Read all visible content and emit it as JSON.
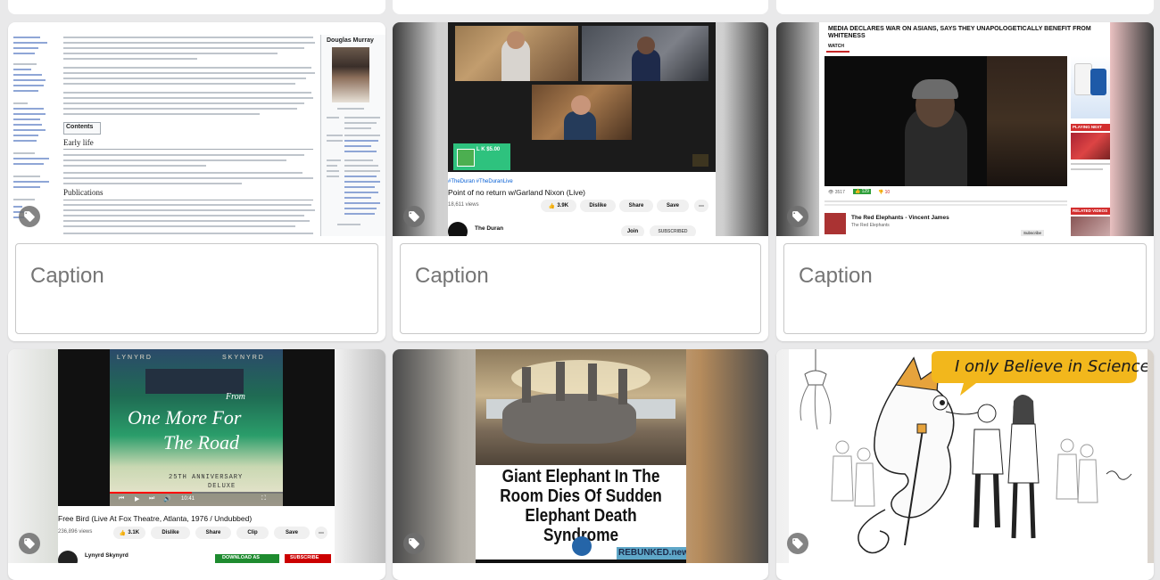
{
  "caption_placeholder": "Caption",
  "cards": {
    "wiki": {
      "infobox_title": "Douglas Murray",
      "section_early_life": "Early life",
      "section_publications": "Publications",
      "contents_label": "Contents"
    },
    "duran": {
      "hashtags": "#TheDuran #TheDuranLive",
      "title": "Point of no return w/Garland Nixon (Live)",
      "views": "18,611 views",
      "likes": "3.9K",
      "dislike": "Dislike",
      "share": "Share",
      "save": "Save",
      "channel": "The Duran",
      "join": "Join",
      "subscribed": "SUBSCRIBED",
      "donation": "L K  $5.00"
    },
    "asians": {
      "headline": "MEDIA DECLARES WAR ON ASIANS, SAYS THEY UNAPOLOGETICALLY BENEFIT FROM WHITENESS",
      "watch": "WATCH",
      "views": "3517",
      "likes": "129",
      "dislikes": "10",
      "channel": "The Red Elephants - Vincent James",
      "channel_sub": "The Red Elephants",
      "subscribe": "Subscribe",
      "playing_next": "PLAYING NEXT",
      "related": "RELATED VIDEOS"
    },
    "skynyrd": {
      "band_left": "LYNYRD",
      "band_right": "SKYNYRD",
      "from": "From",
      "album_line1": "One More For",
      "album_line2": "The Road",
      "anniversary": "25TH ANNIVERSARY",
      "deluxe": "DELUXE",
      "time": "10:41",
      "title": "Free Bird (Live At Fox Theatre, Atlanta, 1976 / Undubbed)",
      "views": "236,896 views",
      "likes": "3.1K",
      "dislike": "Dislike",
      "share": "Share",
      "clip": "Clip",
      "save": "Save",
      "channel": "Lynyrd Skynyrd",
      "download": "DOWNLOAD AS",
      "subscribe": "SUBSCRIBE"
    },
    "elephant": {
      "headline": "Giant Elephant In The Room Dies Of Sudden Elephant Death Syndrome",
      "brand": "REBUNKED.news"
    },
    "cartoon": {
      "speech": "I only Believe in Science."
    }
  },
  "colors": {
    "tag_bg": "#6e6e6e",
    "yt_red": "#cc0000",
    "download_green": "#1e8b2f",
    "speech_yellow": "#f2b71c"
  }
}
